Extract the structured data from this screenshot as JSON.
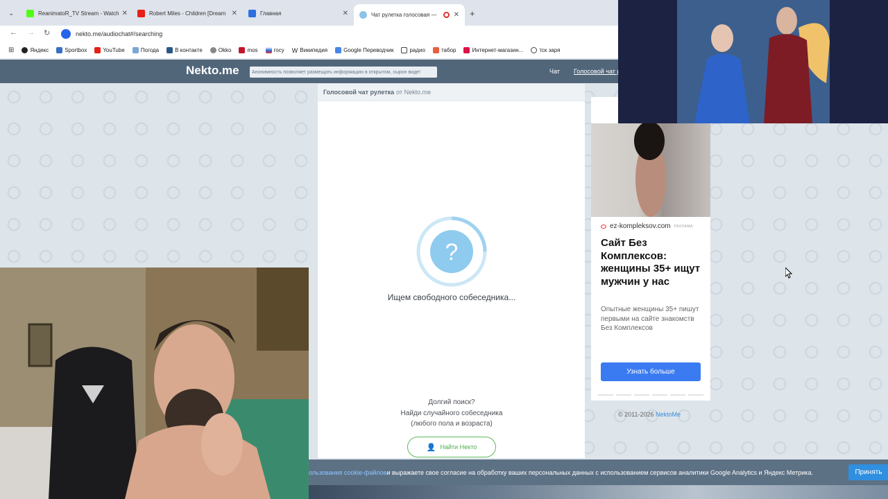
{
  "browser": {
    "tabs": [
      {
        "title": "ReanimatoR_TV Stream - Watch",
        "icon": "kick-icon",
        "color": "#53fc18"
      },
      {
        "title": "Robert Miles - Children [Dream",
        "icon": "youtube-icon",
        "color": "#e62117"
      },
      {
        "title": "Главная",
        "icon": "app-icon",
        "color": "#2f6fe0"
      },
      {
        "title": "Чат рулетка голосовая — ",
        "icon": "nekto-icon",
        "color": "#8cc3e6"
      }
    ],
    "new_tab": "+",
    "url": "nekto.me/audiochat#/searching",
    "bookmarks": [
      {
        "label": "Яндекс",
        "color": "#222"
      },
      {
        "label": "Sportbox",
        "color": "#3a6fc2"
      },
      {
        "label": "YouTube",
        "color": "#e62117"
      },
      {
        "label": "Погода",
        "color": "#7aa6d6"
      },
      {
        "label": "В контакте",
        "color": "#2a5885"
      },
      {
        "label": "Okko",
        "color": "#888"
      },
      {
        "label": "mos",
        "color": "#c4142b"
      },
      {
        "label": "госу",
        "color": "#2f6fe0"
      },
      {
        "label": "Википедия",
        "color": "#555"
      },
      {
        "label": "Google Переводчик",
        "color": "#4a86e8"
      },
      {
        "label": "радио",
        "color": "#444"
      },
      {
        "label": "табор",
        "color": "#e95f3e"
      },
      {
        "label": "Интернет-магазин...",
        "color": "#d14"
      },
      {
        "label": "тск заря",
        "color": "#444"
      }
    ]
  },
  "site": {
    "logo": "Nekto.me",
    "notice": "Анонимность позволяет размещать информацию в открытом, сырон виде!",
    "nav_chat": "Чат",
    "nav_voice": "Голосовой чат р"
  },
  "panel": {
    "head_bold": "Голосовой чат рулетка",
    "head_rest": "от Nekto.me",
    "question": "?",
    "searching": "Ищем свободного собеседника...",
    "long_search": "Долгий поиск?",
    "find_random": "Найди случайного собеседника",
    "any_gender": "(любого пола и возраста)",
    "find_button": "Найти Некто"
  },
  "ad": {
    "domain": "ez-kompleksov.com",
    "label": "РЕКЛАМА",
    "title": "Сайт Без Комплексов: женщины 35+ ищут мужчин у нас",
    "description": "Опытные женщины 35+ пишут первыми на сайте знакомств Без Комплексов",
    "button": "Узнать больше"
  },
  "footer": {
    "copyright": "© 2011-2026 ",
    "link": "NektoMe"
  },
  "cookie": {
    "link_text": "ользования cookie-файлов",
    "text": " и выражаете свое согласие на обработку ваших персональных данных с использованием сервисов аналитики Google Analytics и Яндекс Метрика.",
    "accept": "Принять"
  }
}
